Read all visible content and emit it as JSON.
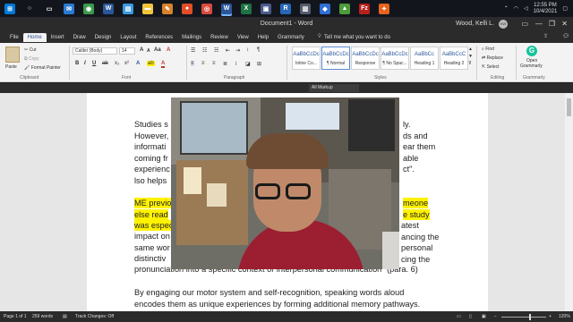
{
  "taskbar": {
    "apps": [
      {
        "icon": "windows-logo-icon",
        "color": "#0078d7",
        "label": "⊞"
      },
      {
        "icon": "search-icon",
        "color": "#12161c",
        "label": "○"
      },
      {
        "icon": "task-view-icon",
        "color": "#12161c",
        "label": "▭"
      },
      {
        "icon": "mail-icon",
        "color": "#2a7ad5",
        "label": "✉"
      },
      {
        "icon": "chrome-icon",
        "color": "#3c9a4c",
        "label": "◉"
      },
      {
        "icon": "word-icon",
        "color": "#2b579a",
        "label": "W"
      },
      {
        "icon": "store-icon",
        "color": "#3b9ae1",
        "label": "▤"
      },
      {
        "icon": "file-explorer-icon",
        "color": "#f2c438",
        "label": "▬"
      },
      {
        "icon": "notes-icon",
        "color": "#d9822b",
        "label": "✎"
      },
      {
        "icon": "firefox-icon",
        "color": "#e34d25",
        "label": "●"
      },
      {
        "icon": "chrome-alt-icon",
        "color": "#d84b3e",
        "label": "◎"
      },
      {
        "icon": "word-active-icon",
        "color": "#2b579a",
        "label": "W"
      },
      {
        "icon": "excel-icon",
        "color": "#1f7244",
        "label": "X"
      },
      {
        "icon": "photos-icon",
        "color": "#4a5b8a",
        "label": "▣"
      },
      {
        "icon": "r-icon",
        "color": "#2766b8",
        "label": "R"
      },
      {
        "icon": "app-icon",
        "color": "#555d6b",
        "label": "▥"
      },
      {
        "icon": "blue-app-icon",
        "color": "#2f6fd6",
        "label": "◆"
      },
      {
        "icon": "green-app-icon",
        "color": "#4c9c3a",
        "label": "▲"
      },
      {
        "icon": "filezilla-icon",
        "color": "#b8201c",
        "label": "Fz"
      },
      {
        "icon": "orange-app-icon",
        "color": "#e8631f",
        "label": "✦"
      }
    ],
    "time": "12:55 PM",
    "date": "10/4/2021"
  },
  "titlebar": {
    "title": "Document1 - Word",
    "user": "Wood, Kelli L.",
    "initials": "KW"
  },
  "tabs": [
    "File",
    "Home",
    "Insert",
    "Draw",
    "Design",
    "Layout",
    "References",
    "Mailings",
    "Review",
    "View",
    "Help",
    "Grammarly"
  ],
  "tell_me": "Tell me what you want to do",
  "ribbon": {
    "clipboard": {
      "paste": "Paste",
      "cut": "Cut",
      "copy": "Copy",
      "format_painter": "Format Painter",
      "label": "Clipboard"
    },
    "font": {
      "name": "Calibri (Body)",
      "size": "14",
      "label": "Font"
    },
    "paragraph": {
      "label": "Paragraph"
    },
    "styles": {
      "items": [
        {
          "preview": "AaBbCcDc",
          "name": "Inline Co..."
        },
        {
          "preview": "AaBbCcDc",
          "name": "¶ Normal"
        },
        {
          "preview": "AaBbCcDc",
          "name": "Response"
        },
        {
          "preview": "AaBbCcDc",
          "name": "¶ No Spac..."
        },
        {
          "preview": "AaBbCc",
          "name": "Heading 1"
        },
        {
          "preview": "AaBbCcC",
          "name": "Heading 2"
        }
      ],
      "label": "Styles"
    },
    "editing": {
      "find": "Find",
      "replace": "Replace",
      "select": "Select",
      "label": "Editing"
    },
    "grammarly": {
      "open": "Open",
      "grammarly": "Grammarly",
      "label": "Grammarly"
    }
  },
  "markup": "All Markup",
  "document": {
    "lines": [
      "Studies s",
      "However,",
      "informati",
      "coming fr",
      "experienc",
      "lso helps"
    ],
    "lines_right": [
      "ly.",
      "ds and",
      "ear them",
      "able",
      "ct\".",
      ""
    ],
    "hl_left": [
      "ME previo",
      "else read",
      "was espec"
    ],
    "hl_right": [
      "meone",
      "e study",
      ""
    ],
    "para2_left": [
      "impact on",
      "same wor",
      "distinctiv"
    ],
    "para2_right": [
      "atest",
      "ancing the",
      "personal",
      "cing the"
    ],
    "para2_last": "pronunciation into a specific context or interpersonal communication\" (para. 6)",
    "para3": [
      "By engaging our motor system and self-recognition, speaking words aloud",
      "encodes them as unique experiences by forming additional memory pathways."
    ]
  },
  "status": {
    "page": "Page 1 of 1",
    "words": "259 words",
    "track": "Track Changes: Off",
    "zoom": "120%"
  }
}
